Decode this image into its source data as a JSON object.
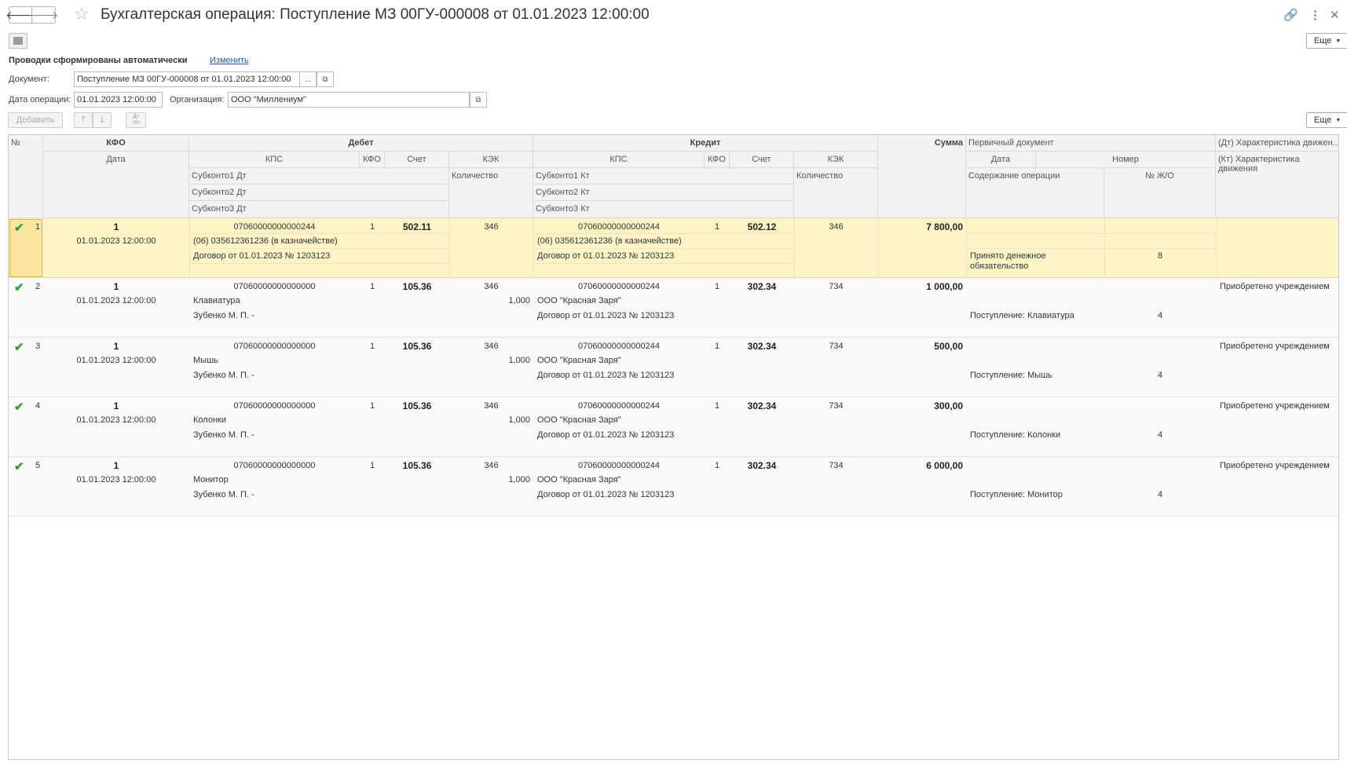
{
  "window": {
    "title": "Бухгалтерская операция: Поступление МЗ 00ГУ-000008 от 01.01.2023 12:00:00",
    "more_label": "Еще"
  },
  "form": {
    "auto_text": "Проводки сформированы автоматически",
    "change_link": "Изменить",
    "document_label": "Документ:",
    "document_value": "Поступление МЗ 00ГУ-000008 от 01.01.2023 12:00:00",
    "date_label": "Дата операции:",
    "date_value": "01.01.2023 12:00:00",
    "org_label": "Организация:",
    "org_value": "ООО \"Миллениум\"",
    "ellipsis": "...",
    "add_label": "Добавить",
    "more_label": "Еще"
  },
  "headers": {
    "num": "№",
    "kfo": "КФО",
    "date": "Дата",
    "debit": "Дебет",
    "credit": "Кредит",
    "kps": "КПС",
    "kfo_small": "КФО",
    "account": "Счет",
    "kek": "КЭК",
    "qty": "Количество",
    "sub1_dt": "Субконто1 Дт",
    "sub2_dt": "Субконто2 Дт",
    "sub3_dt": "Субконто3 Дт",
    "sub1_kt": "Субконто1 Кт",
    "sub2_kt": "Субконто2 Кт",
    "sub3_kt": "Субконто3 Кт",
    "sum": "Сумма",
    "primary_doc": "Первичный документ",
    "pd_date": "Дата",
    "pd_number": "Номер",
    "content": "Содержание операции",
    "journal_no": "№ Ж/О",
    "dt_char": "(Дт) Характеристика движен...",
    "kt_char": "(Кт) Характеристика движения"
  },
  "rows": [
    {
      "n": "1",
      "kfo": "1",
      "date": "01.01.2023 12:00:00",
      "dt_kps": "07060000000000244",
      "dt_kfo": "1",
      "dt_acc": "502.11",
      "dt_kek": "346",
      "dt_sub1": "(06) 035612361236 (в казначействе)",
      "dt_sub2": "Договор от 01.01.2023 № 1203123",
      "dt_qty": "",
      "kt_kps": "07060000000000244",
      "kt_kfo": "1",
      "kt_acc": "502.12",
      "kt_kek": "346",
      "kt_sub1": "(06) 035612361236 (в казначействе)",
      "kt_sub2": "Договор от 01.01.2023 № 1203123",
      "sum": "7 800,00",
      "content": "Принято денежное обязательство",
      "journal": "8",
      "char": ""
    },
    {
      "n": "2",
      "kfo": "1",
      "date": "01.01.2023 12:00:00",
      "dt_kps": "07060000000000000",
      "dt_kfo": "1",
      "dt_acc": "105.36",
      "dt_kek": "346",
      "dt_sub1": "Клавиатура",
      "dt_sub2": "Зубенко М. П. -",
      "dt_qty": "1,000",
      "kt_kps": "07060000000000244",
      "kt_kfo": "1",
      "kt_acc": "302.34",
      "kt_kek": "734",
      "kt_sub1": "ООО \"Красная Заря\"",
      "kt_sub2": "Договор от 01.01.2023 № 1203123",
      "sum": "1 000,00",
      "content": "Поступление: Клавиатура",
      "journal": "4",
      "char": "Приобретено учреждением"
    },
    {
      "n": "3",
      "kfo": "1",
      "date": "01.01.2023 12:00:00",
      "dt_kps": "07060000000000000",
      "dt_kfo": "1",
      "dt_acc": "105.36",
      "dt_kek": "346",
      "dt_sub1": "Мышь",
      "dt_sub2": "Зубенко М. П. -",
      "dt_qty": "1,000",
      "kt_kps": "07060000000000244",
      "kt_kfo": "1",
      "kt_acc": "302.34",
      "kt_kek": "734",
      "kt_sub1": "ООО \"Красная Заря\"",
      "kt_sub2": "Договор от 01.01.2023 № 1203123",
      "sum": "500,00",
      "content": "Поступление: Мышь",
      "journal": "4",
      "char": "Приобретено учреждением"
    },
    {
      "n": "4",
      "kfo": "1",
      "date": "01.01.2023 12:00:00",
      "dt_kps": "07060000000000000",
      "dt_kfo": "1",
      "dt_acc": "105.36",
      "dt_kek": "346",
      "dt_sub1": "Колонки",
      "dt_sub2": "Зубенко М. П. -",
      "dt_qty": "1,000",
      "kt_kps": "07060000000000244",
      "kt_kfo": "1",
      "kt_acc": "302.34",
      "kt_kek": "734",
      "kt_sub1": "ООО \"Красная Заря\"",
      "kt_sub2": "Договор от 01.01.2023 № 1203123",
      "sum": "300,00",
      "content": "Поступление: Колонки",
      "journal": "4",
      "char": "Приобретено учреждением"
    },
    {
      "n": "5",
      "kfo": "1",
      "date": "01.01.2023 12:00:00",
      "dt_kps": "07060000000000000",
      "dt_kfo": "1",
      "dt_acc": "105.36",
      "dt_kek": "346",
      "dt_sub1": "Монитор",
      "dt_sub2": "Зубенко М. П. -",
      "dt_qty": "1,000",
      "kt_kps": "07060000000000244",
      "kt_kfo": "1",
      "kt_acc": "302.34",
      "kt_kek": "734",
      "kt_sub1": "ООО \"Красная Заря\"",
      "kt_sub2": "Договор от 01.01.2023 № 1203123",
      "sum": "6 000,00",
      "content": "Поступление: Монитор",
      "journal": "4",
      "char": "Приобретено учреждением"
    }
  ]
}
